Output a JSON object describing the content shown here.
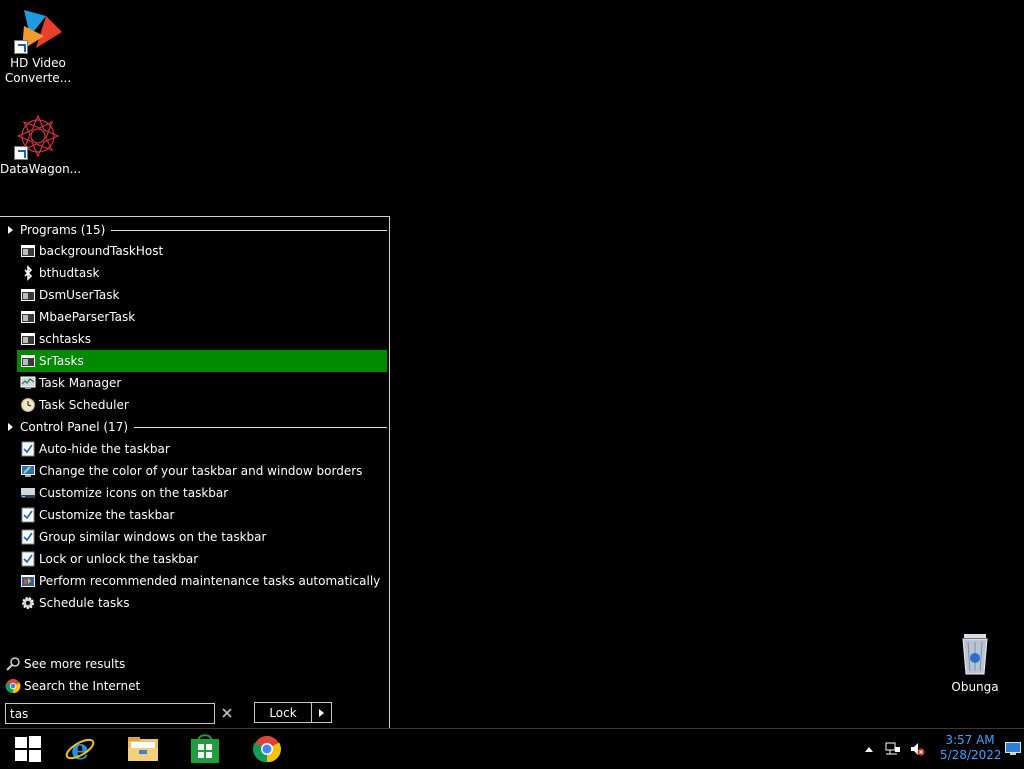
{
  "desktop": {
    "icons": [
      {
        "name": "HD Video Converte...",
        "icon": "hd-video-converter-icon"
      },
      {
        "name": "DataWagon...",
        "icon": "datawagon-icon"
      },
      {
        "name": "Obunga",
        "icon": "recycle-bin-icon"
      }
    ]
  },
  "start_menu": {
    "programs_header": "Programs (15)",
    "programs": [
      {
        "label": "backgroundTaskHost",
        "icon": "app-window-icon",
        "selected": false
      },
      {
        "label": "bthudtask",
        "icon": "bluetooth-icon",
        "selected": false
      },
      {
        "label": "DsmUserTask",
        "icon": "app-window-icon",
        "selected": false
      },
      {
        "label": "MbaeParserTask",
        "icon": "app-window-icon",
        "selected": false
      },
      {
        "label": "schtasks",
        "icon": "app-window-icon",
        "selected": false
      },
      {
        "label": "SrTasks",
        "icon": "app-window-icon",
        "selected": true
      },
      {
        "label": "Task Manager",
        "icon": "task-manager-icon",
        "selected": false
      },
      {
        "label": "Task Scheduler",
        "icon": "clock-icon",
        "selected": false
      }
    ],
    "control_panel_header": "Control Panel (17)",
    "control_panel": [
      {
        "label": "Auto-hide the taskbar",
        "icon": "checklist-icon"
      },
      {
        "label": "Change the color of your taskbar and window borders",
        "icon": "monitor-color-icon"
      },
      {
        "label": "Customize icons on the taskbar",
        "icon": "taskbar-icon"
      },
      {
        "label": "Customize the taskbar",
        "icon": "checklist-icon"
      },
      {
        "label": "Group similar windows on the taskbar",
        "icon": "checklist-icon"
      },
      {
        "label": "Lock or unlock the taskbar",
        "icon": "checklist-icon"
      },
      {
        "label": "Perform recommended maintenance tasks automatically",
        "icon": "action-center-icon"
      },
      {
        "label": "Schedule tasks",
        "icon": "gear-clock-icon"
      }
    ],
    "see_more": "See more results",
    "search_internet": "Search the Internet",
    "search_value": "tas",
    "lock_label": "Lock"
  },
  "taskbar": {
    "pinned": [
      "windows-start-icon",
      "internet-explorer-icon",
      "file-explorer-icon",
      "store-icon",
      "chrome-icon"
    ],
    "time": "3:57 AM",
    "date": "5/28/2022"
  },
  "colors": {
    "selection": "#008a00",
    "clock": "#3aa3ff",
    "background": "#000000"
  }
}
